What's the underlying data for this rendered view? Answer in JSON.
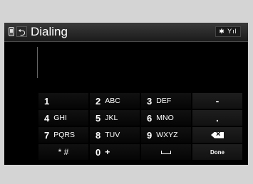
{
  "header": {
    "title": "Dialing",
    "back_glyph": "⮌",
    "status_text": "✱ Yıl"
  },
  "keypad": {
    "keys": [
      {
        "digit": "1",
        "letters": ""
      },
      {
        "digit": "2",
        "letters": "ABC"
      },
      {
        "digit": "3",
        "letters": "DEF"
      },
      {
        "label": "-"
      },
      {
        "digit": "4",
        "letters": "GHI"
      },
      {
        "digit": "5",
        "letters": "JKL"
      },
      {
        "digit": "6",
        "letters": "MNO"
      },
      {
        "label": "."
      },
      {
        "digit": "7",
        "letters": "PQRS"
      },
      {
        "digit": "8",
        "letters": "TUV"
      },
      {
        "digit": "9",
        "letters": "WXYZ"
      },
      {
        "icon": "backspace-icon"
      },
      {
        "label": "* #"
      },
      {
        "digit": "0",
        "letters": "+"
      },
      {
        "icon": "space-icon"
      },
      {
        "label": "Done"
      }
    ]
  }
}
